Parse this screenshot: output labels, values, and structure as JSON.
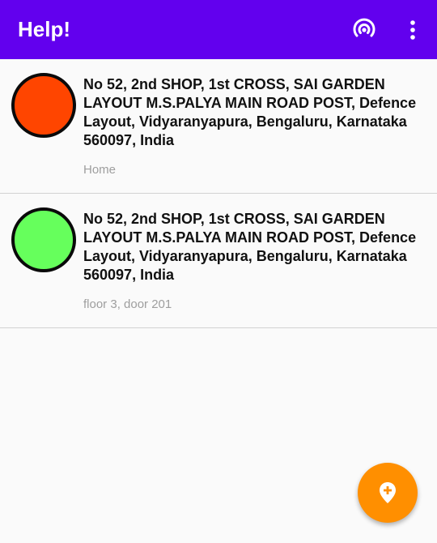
{
  "appbar": {
    "title": "Help!",
    "color": "#6200ee",
    "actions": [
      {
        "icon": "broadcast-icon"
      },
      {
        "icon": "more-vert-icon"
      }
    ]
  },
  "places": [
    {
      "status_color": "#ff4500",
      "address": "No 52, 2nd SHOP, 1st CROSS, SAI GARDEN LAYOUT M.S.PALYA MAIN ROAD POST, Defence Layout, Vidyaranyapura, Bengaluru, Karnataka 560097, India",
      "label": "Home"
    },
    {
      "status_color": "#66ff5c",
      "address": "No 52, 2nd SHOP, 1st CROSS, SAI GARDEN LAYOUT M.S.PALYA MAIN ROAD POST, Defence Layout, Vidyaranyapura, Bengaluru, Karnataka 560097, India",
      "label": "floor 3, door 201"
    }
  ],
  "fab": {
    "icon": "add-location-icon",
    "color": "#ff8f00"
  }
}
